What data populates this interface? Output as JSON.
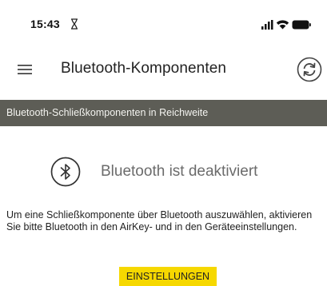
{
  "status_bar": {
    "time": "15:43",
    "hourglass_icon": "hourglass-icon",
    "signal_icon": "signal-icon",
    "wifi_icon": "wifi-icon",
    "battery_icon": "battery-icon"
  },
  "app_bar": {
    "title": "Bluetooth-Komponenten",
    "menu_icon": "menu-icon",
    "refresh_icon": "refresh-icon"
  },
  "section": {
    "header": "Bluetooth-Schließkomponenten in Reichweite",
    "background": "#5d5d56"
  },
  "bluetooth": {
    "icon": "bluetooth-icon",
    "status_text": "Bluetooth ist deaktiviert"
  },
  "info_text": "Um eine Schließkomponente über Bluetooth auszuwählen, aktivieren Sie bitte Bluetooth in den AirKey- und in den Geräteeinstellungen.",
  "settings_button": {
    "label": "EINSTELLUNGEN",
    "color": "#f6d800"
  }
}
